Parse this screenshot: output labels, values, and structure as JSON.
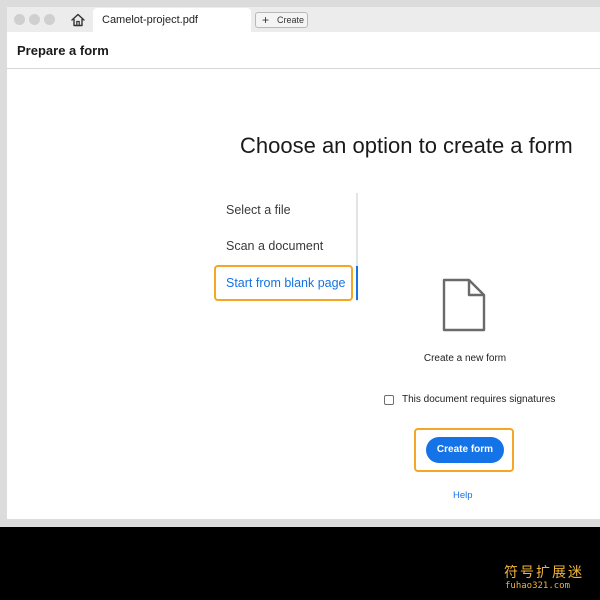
{
  "tabbar": {
    "document_tab": "Camelot-project.pdf",
    "create_tab": "Create",
    "home_icon": "home-icon",
    "plus_icon": "+"
  },
  "header": {
    "title": "Prepare a form"
  },
  "main": {
    "heading": "Choose an option to create a form",
    "options": [
      {
        "label": "Select a file",
        "selected": false
      },
      {
        "label": "Scan a document",
        "selected": false
      },
      {
        "label": "Start from blank page",
        "selected": true
      }
    ],
    "panel": {
      "icon": "blank-document-icon",
      "caption": "Create a new form",
      "checkbox_label": "This document requires signatures",
      "checkbox_checked": false,
      "button_label": "Create form",
      "help_link": "Help"
    }
  },
  "colors": {
    "accent": "#1473e6",
    "highlight": "#f5a623"
  },
  "watermark": {
    "main": "符号扩展迷",
    "sub": "fuhao321.com"
  }
}
